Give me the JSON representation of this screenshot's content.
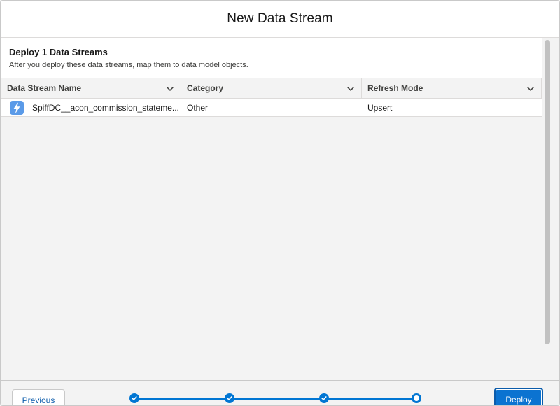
{
  "modal": {
    "title": "New Data Stream"
  },
  "intro": {
    "heading": "Deploy 1 Data Streams",
    "description": "After you deploy these data streams, map them to data model objects."
  },
  "table": {
    "columns": [
      "Data Stream Name",
      "Category",
      "Refresh Mode"
    ],
    "rows": [
      {
        "name": "SpiffDC__acon_commission_stateme...",
        "category": "Other",
        "refresh_mode": "Upsert"
      }
    ]
  },
  "footer": {
    "previous_label": "Previous",
    "deploy_label": "Deploy",
    "progress": {
      "total_steps": 4,
      "completed_steps": 3,
      "current_step": 4
    }
  },
  "colors": {
    "brand_blue": "#0176d3",
    "stream_icon_bg": "#5a9ae8"
  },
  "icons": {
    "stream": "lightning-bolt-icon",
    "column_menu": "chevron-down-icon",
    "step_complete": "check-icon"
  }
}
